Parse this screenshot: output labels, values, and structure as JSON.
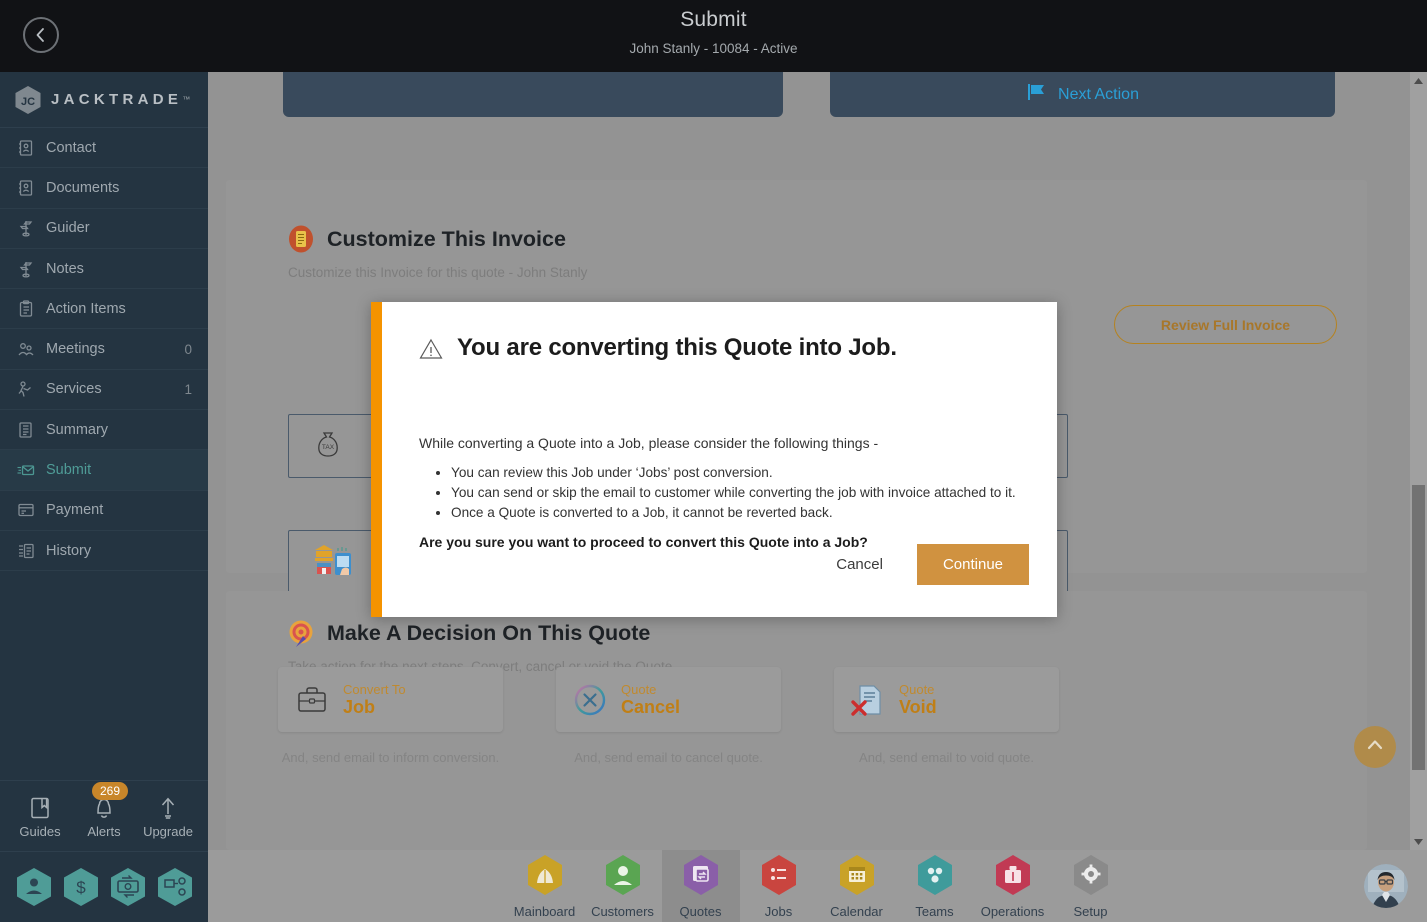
{
  "topbar": {
    "back_icon": "chevron-left-icon",
    "title": "Submit",
    "subtitle": "John Stanly - 10084 - Active"
  },
  "sidebar": {
    "brand": "JACKTRADE",
    "brand_tm": "™",
    "items": [
      {
        "label": "Contact",
        "icon": "contact-card-icon",
        "count": "",
        "active": false
      },
      {
        "label": "Documents",
        "icon": "document-icon",
        "count": "",
        "active": false
      },
      {
        "label": "Guider",
        "icon": "signpost-icon",
        "count": "",
        "active": false
      },
      {
        "label": "Notes",
        "icon": "signpost-icon",
        "count": "",
        "active": false
      },
      {
        "label": "Action Items",
        "icon": "clipboard-icon",
        "count": "",
        "active": false
      },
      {
        "label": "Meetings",
        "icon": "meeting-icon",
        "count": "0",
        "active": false
      },
      {
        "label": "Services",
        "icon": "services-icon",
        "count": "1",
        "active": false
      },
      {
        "label": "Summary",
        "icon": "book-icon",
        "count": "",
        "active": false
      },
      {
        "label": "Submit",
        "icon": "send-mail-icon",
        "count": "",
        "active": true
      },
      {
        "label": "Payment",
        "icon": "payment-card-icon",
        "count": "",
        "active": false
      },
      {
        "label": "History",
        "icon": "history-list-icon",
        "count": "",
        "active": false
      }
    ],
    "tools": [
      {
        "label": "Guides",
        "icon": "book-bookmark-icon",
        "badge": ""
      },
      {
        "label": "Alerts",
        "icon": "bell-icon",
        "badge": "269"
      },
      {
        "label": "Upgrade",
        "icon": "arrow-up-icon",
        "badge": ""
      }
    ],
    "quick_hexes": [
      {
        "icon": "person-hex-icon"
      },
      {
        "icon": "dollar-hex-icon"
      },
      {
        "icon": "money-transfer-hex-icon"
      },
      {
        "icon": "workflow-hex-icon"
      }
    ]
  },
  "content": {
    "next_action": {
      "label": "Next Action",
      "icon": "flag-icon"
    },
    "invoice_section": {
      "icon": "invoice-icon",
      "title": "Customize This Invoice",
      "subtitle": "Customize this Invoice for this quote - John Stanly",
      "review_button": "Review Full Invoice",
      "tiles": [
        {
          "icon": "tax-moneybag-icon"
        },
        {
          "icon": "bank-payment-icon"
        }
      ]
    },
    "decision_section": {
      "icon": "target-icon",
      "title": "Make A Decision On This Quote",
      "subtitle": "Take action for the next steps. Convert, cancel or void the Quote",
      "cards": [
        {
          "icon": "briefcase-icon",
          "line1": "Convert To",
          "line2": "Job",
          "note": "And, send email to inform conversion."
        },
        {
          "icon": "circle-x-icon",
          "line1": "Quote",
          "line2": "Cancel",
          "note": "And, send email to cancel quote."
        },
        {
          "icon": "void-doc-icon",
          "line1": "Quote",
          "line2": "Void",
          "note": "And, send email to void quote."
        }
      ]
    },
    "scroll_top_icon": "chevron-up-icon"
  },
  "scrollbar": {
    "up_icon": "triangle-up-icon",
    "down_icon": "triangle-down-icon"
  },
  "bottomnav": {
    "items": [
      {
        "label": "Mainboard",
        "icon": "mainboard-hex-icon",
        "color": "#c9a227",
        "active": false
      },
      {
        "label": "Customers",
        "icon": "customers-hex-icon",
        "color": "#5aa552",
        "active": false
      },
      {
        "label": "Quotes",
        "icon": "quotes-hex-icon",
        "color": "#8a5fa8",
        "active": true
      },
      {
        "label": "Jobs",
        "icon": "jobs-hex-icon",
        "color": "#c9453f",
        "active": false
      },
      {
        "label": "Calendar",
        "icon": "calendar-hex-icon",
        "color": "#c9a227",
        "active": false
      },
      {
        "label": "Teams",
        "icon": "teams-hex-icon",
        "color": "#3f9b9b",
        "active": false
      },
      {
        "label": "Operations",
        "icon": "operations-hex-icon",
        "color": "#c13a54",
        "active": false
      },
      {
        "label": "Setup",
        "icon": "setup-hex-icon",
        "color": "#8a8a8a",
        "active": false
      }
    ],
    "avatar": "user-avatar"
  },
  "modal": {
    "warning_icon": "warning-triangle-icon",
    "title": "You are converting this Quote into Job.",
    "intro": "While converting a Quote into a Job, please consider the following things -",
    "bullets": [
      "You can review this Job under ‘Jobs’ post conversion.",
      "You can send or skip the email to customer while converting the job with invoice attached to it.",
      "Once a Quote is converted to a Job, it cannot be reverted back."
    ],
    "confirm": "Are you sure you want to proceed to convert this Quote into a Job?",
    "cancel_label": "Cancel",
    "continue_label": "Continue",
    "accent_color": "#f59300",
    "continue_color": "#d09240"
  }
}
